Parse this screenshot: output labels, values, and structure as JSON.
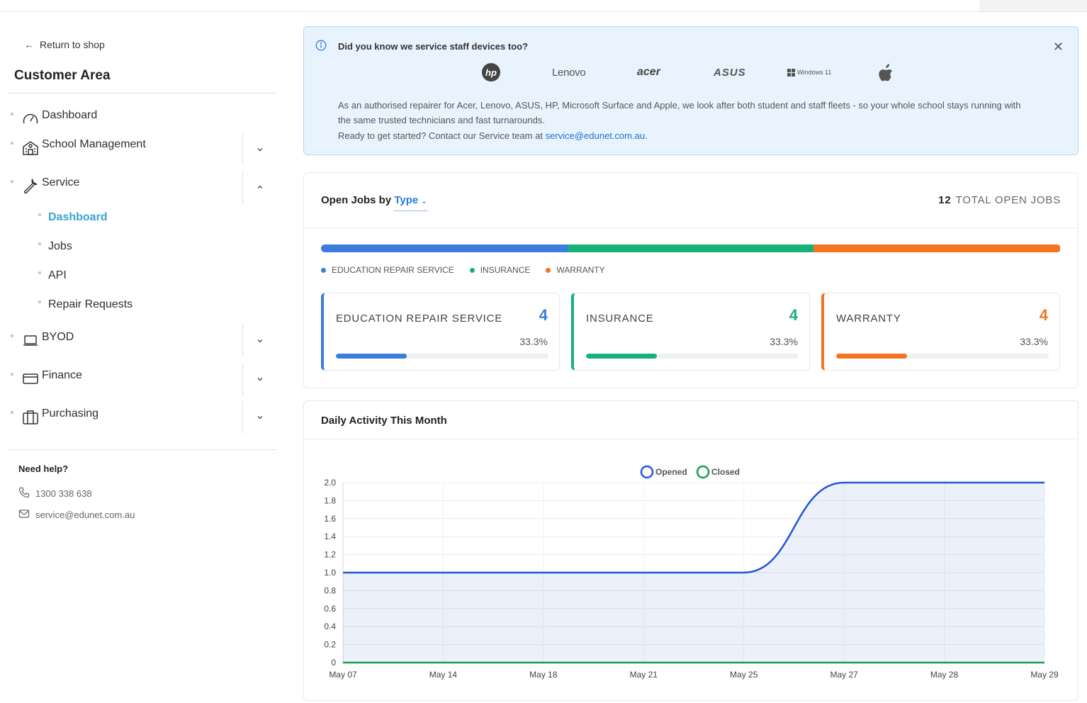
{
  "sidebar": {
    "return_label": "Return to shop",
    "title": "Customer Area",
    "items": [
      {
        "label": "Dashboard",
        "icon": "speedometer-icon"
      },
      {
        "label": "School Management",
        "icon": "school-icon"
      },
      {
        "label": "Service",
        "icon": "wrench-icon"
      },
      {
        "label": "BYOD",
        "icon": "laptop-icon"
      },
      {
        "label": "Finance",
        "icon": "credit-card-icon"
      },
      {
        "label": "Purchasing",
        "icon": "briefcase-icon"
      }
    ],
    "service_sub": [
      {
        "label": "Dashboard",
        "active": true
      },
      {
        "label": "Jobs"
      },
      {
        "label": "API"
      },
      {
        "label": "Repair Requests"
      }
    ],
    "help": {
      "title": "Need help?",
      "phone": "1300 338 638",
      "email": "service@edunet.com.au"
    }
  },
  "banner": {
    "title": "Did you know we service staff devices too?",
    "logos": [
      "hp",
      "Lenovo",
      "acer",
      "ASUS",
      "Windows 11",
      "apple"
    ],
    "text": "As an authorised repairer for Acer, Lenovo, ASUS, HP, Microsoft Surface and Apple, we look after both student and staff fleets - so your whole school stays running with the same trusted technicians and fast turnarounds.",
    "contact_prefix": "Ready to get started? Contact our Service team at",
    "contact_email": "service@edunet.com.au."
  },
  "jobs": {
    "title_prefix": "Open Jobs by",
    "type_label": "Type",
    "total_count": "12",
    "total_label": "TOTAL OPEN JOBS",
    "types": [
      {
        "name": "EDUCATION REPAIR SERVICE",
        "legend": "EDUCATION REPAIR SERVICE",
        "count": "4",
        "pct": "33.3%",
        "share": 0.333,
        "color": "#3b7ddd"
      },
      {
        "name": "INSURANCE",
        "legend": "INSURANCE",
        "count": "4",
        "pct": "33.3%",
        "share": 0.333,
        "color": "#17b27a"
      },
      {
        "name": "WARRANTY",
        "legend": "WARRANTY",
        "count": "4",
        "pct": "33.3%",
        "share": 0.333,
        "color": "#f47422"
      }
    ]
  },
  "activity": {
    "title": "Daily Activity This Month",
    "chart_data": {
      "type": "line",
      "categories": [
        "May 07",
        "May 14",
        "May 18",
        "May 21",
        "May 25",
        "May 27",
        "May 28",
        "May 29"
      ],
      "series": [
        {
          "name": "Opened",
          "values": [
            1,
            1,
            1,
            1,
            1,
            2,
            2,
            2
          ],
          "color": "#2357d4"
        },
        {
          "name": "Closed",
          "values": [
            0,
            0,
            0,
            0,
            0,
            0,
            0,
            0
          ],
          "color": "#1a9e4a"
        }
      ],
      "ylim": [
        0,
        2.0
      ],
      "yticks": [
        "0",
        "0.2",
        "0.4",
        "0.6",
        "0.8",
        "1.0",
        "1.2",
        "1.4",
        "1.6",
        "1.8",
        "2.0"
      ],
      "grid": true,
      "legend": "top"
    }
  }
}
